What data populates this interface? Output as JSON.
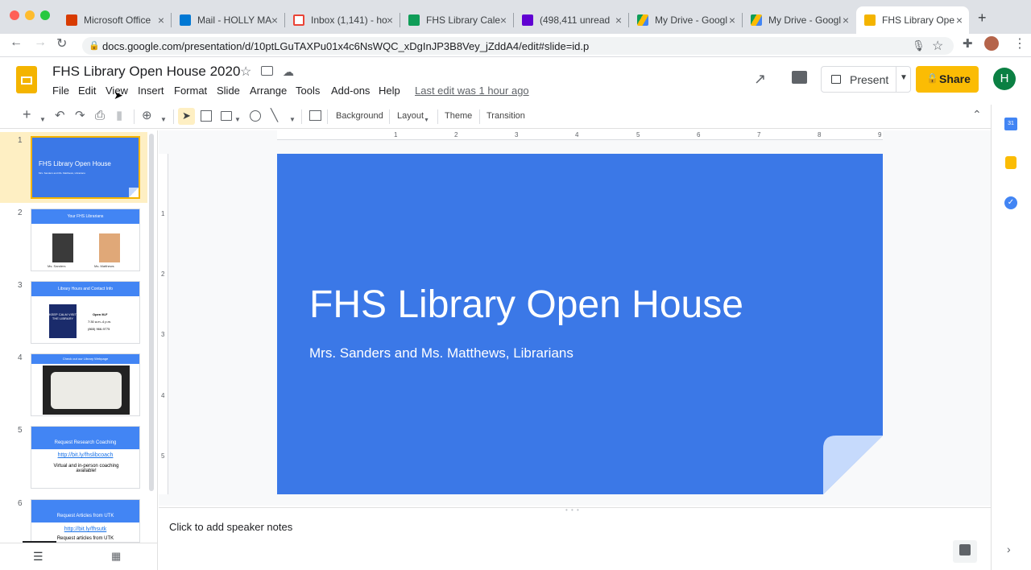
{
  "browser": {
    "tabs": [
      {
        "title": "Microsoft Office",
        "color": "#d83b01"
      },
      {
        "title": "Mail - HOLLY MA",
        "color": "#0078d4"
      },
      {
        "title": "Inbox (1,141) - ho",
        "color": "#ea4335"
      },
      {
        "title": "FHS Library Cale",
        "color": "#0f9d58"
      },
      {
        "title": "(498,411 unread",
        "color": "#6001d2"
      },
      {
        "title": "My Drive - Googl",
        "color": "#fbbc04"
      },
      {
        "title": "My Drive - Googl",
        "color": "#fbbc04"
      },
      {
        "title": "FHS Library Ope",
        "color": "#f4b400"
      }
    ],
    "url": "docs.google.com/presentation/d/10ptLGuTAXPu01x4c6NsWQC_xDgInJP3B8Vey_jZddA4/edit#slide=id.p"
  },
  "doc": {
    "title": "FHS Library Open House 2020",
    "menus": [
      "File",
      "Edit",
      "View",
      "Insert",
      "Format",
      "Slide",
      "Arrange",
      "Tools",
      "Add-ons",
      "Help"
    ],
    "last_edit": "Last edit was 1 hour ago",
    "present_label": "Present",
    "share_label": "Share",
    "avatar_letter": "H"
  },
  "toolbar": {
    "background": "Background",
    "layout": "Layout",
    "theme": "Theme",
    "transition": "Transition"
  },
  "ruler_h": [
    "1",
    "2",
    "3",
    "4",
    "5",
    "6",
    "7",
    "8",
    "9"
  ],
  "ruler_v": [
    "1",
    "2",
    "3",
    "4",
    "5"
  ],
  "slides": [
    {
      "num": "1",
      "title": "FHS Library Open House",
      "subtitle": "Mrs. Sanders and Ms. Matthews, Librarians"
    },
    {
      "num": "2",
      "title": "Your FHS Librarians",
      "cap1": "Ms. Sanders",
      "cap2": "Ms. Matthews"
    },
    {
      "num": "3",
      "title": "Library Hours and Contact Info",
      "hours1": "Open M-F",
      "hours2": "7:30 a.m.-4 p.m.",
      "hours3": "(865) 966-9775",
      "poster": "KEEP CALM VISIT THE LIBRARY"
    },
    {
      "num": "4",
      "title": "Check out our Library Webpage"
    },
    {
      "num": "5",
      "title": "Request Research Coaching",
      "link": "http://bit.ly/fhslibcoach",
      "body": "Virtual and in-person coaching available!"
    },
    {
      "num": "6",
      "title": "Request Articles from UTK",
      "link": "http://bit.ly/fhsutk",
      "body": "Request articles from UTK"
    }
  ],
  "main_slide": {
    "title": "FHS Library Open House",
    "subtitle": "Mrs. Sanders and Ms. Matthews, Librarians"
  },
  "notes_placeholder": "Click to add speaker notes",
  "colors": {
    "slide_bg": "#3b78e7",
    "share_yellow": "#fbbc04",
    "selected_thumb_bg": "#feefc3",
    "avatar": "#0b8043"
  }
}
